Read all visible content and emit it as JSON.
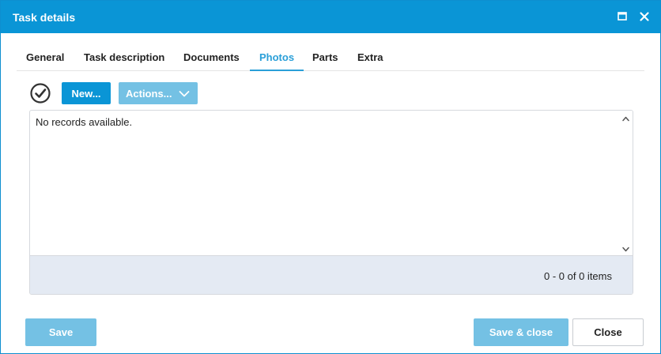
{
  "window": {
    "title": "Task details",
    "maximize_icon": "maximize-icon",
    "close_icon": "close-icon"
  },
  "tabs": [
    {
      "label": "General",
      "active": false
    },
    {
      "label": "Task description",
      "active": false
    },
    {
      "label": "Documents",
      "active": false
    },
    {
      "label": "Photos",
      "active": true
    },
    {
      "label": "Parts",
      "active": false
    },
    {
      "label": "Extra",
      "active": false
    }
  ],
  "toolbar": {
    "select_all_icon": "check-circle-icon",
    "new_label": "New...",
    "actions_label": "Actions...",
    "actions_icon": "chevron-down-icon"
  },
  "grid": {
    "empty_message": "No records available.",
    "pager_info": "0 - 0 of 0 items"
  },
  "footer": {
    "save_label": "Save",
    "save_close_label": "Save & close",
    "close_label": "Close"
  },
  "colors": {
    "accent": "#0a95d6",
    "accent_light": "#74c1e4",
    "active_tab": "#2a9fd8",
    "grid_footer": "#e4eaf3"
  }
}
